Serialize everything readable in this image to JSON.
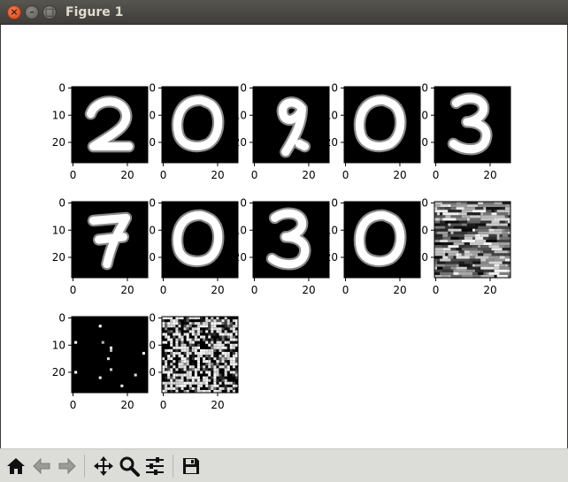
{
  "window": {
    "title": "Figure 1",
    "close_glyph": "×",
    "minimize_glyph": "–",
    "maximize_glyph": "□"
  },
  "figure": {
    "rows": 3,
    "cols": 5,
    "colormap": "gray",
    "background_color": "#ffffff",
    "subplots": [
      {
        "row": 0,
        "col": 0,
        "content": "digit",
        "label": "2",
        "ytick_labels": [
          "0",
          "10",
          "20"
        ],
        "xtick_labels": [
          "0",
          "20"
        ]
      },
      {
        "row": 0,
        "col": 1,
        "content": "digit",
        "label": "0",
        "ytick_labels": [
          "0",
          "10",
          "20"
        ],
        "xtick_labels": [
          "0",
          "20"
        ]
      },
      {
        "row": 0,
        "col": 2,
        "content": "digit",
        "label": "9",
        "ytick_labels": [
          "0",
          "10",
          "20"
        ],
        "xtick_labels": [
          "0",
          "20"
        ]
      },
      {
        "row": 0,
        "col": 3,
        "content": "digit",
        "label": "0",
        "ytick_labels": [
          "0",
          "10",
          "20"
        ],
        "xtick_labels": [
          "0",
          "20"
        ]
      },
      {
        "row": 0,
        "col": 4,
        "content": "digit",
        "label": "3",
        "ytick_labels": [
          "0",
          "10",
          "20"
        ],
        "xtick_labels": [
          "0",
          "20"
        ]
      },
      {
        "row": 1,
        "col": 0,
        "content": "digit",
        "label": "7",
        "ytick_labels": [
          "0",
          "10",
          "20"
        ],
        "xtick_labels": [
          "0",
          "20"
        ]
      },
      {
        "row": 1,
        "col": 1,
        "content": "digit",
        "label": "0",
        "ytick_labels": [
          "0",
          "10",
          "20"
        ],
        "xtick_labels": [
          "0",
          "20"
        ]
      },
      {
        "row": 1,
        "col": 2,
        "content": "digit",
        "label": "3",
        "ytick_labels": [
          "0",
          "10",
          "20"
        ],
        "xtick_labels": [
          "0",
          "20"
        ]
      },
      {
        "row": 1,
        "col": 3,
        "content": "digit",
        "label": "0",
        "ytick_labels": [
          "0",
          "10",
          "20"
        ],
        "xtick_labels": [
          "0",
          "20"
        ]
      },
      {
        "row": 1,
        "col": 4,
        "content": "noise-stripes",
        "label": "",
        "ytick_labels": [
          "0",
          "10",
          "20"
        ],
        "xtick_labels": [
          "0",
          "20"
        ]
      },
      {
        "row": 2,
        "col": 0,
        "content": "sparse-dots",
        "label": "",
        "ytick_labels": [
          "0",
          "10",
          "20"
        ],
        "xtick_labels": [
          "0",
          "20"
        ]
      },
      {
        "row": 2,
        "col": 1,
        "content": "noise-dense",
        "label": "",
        "ytick_labels": [
          "0",
          "10",
          "20"
        ],
        "xtick_labels": [
          "0",
          "20"
        ]
      }
    ]
  },
  "toolbar": {
    "buttons": [
      {
        "name": "home-button",
        "icon": "home-icon",
        "enabled": true
      },
      {
        "name": "back-button",
        "icon": "arrow-left-icon",
        "enabled": false
      },
      {
        "name": "forward-button",
        "icon": "arrow-right-icon",
        "enabled": false
      },
      {
        "name": "pan-button",
        "icon": "move-icon",
        "enabled": true
      },
      {
        "name": "zoom-button",
        "icon": "magnifier-icon",
        "enabled": true
      },
      {
        "name": "subplots-config-button",
        "icon": "sliders-icon",
        "enabled": true
      },
      {
        "name": "save-button",
        "icon": "floppy-disk-icon",
        "enabled": true
      }
    ]
  }
}
